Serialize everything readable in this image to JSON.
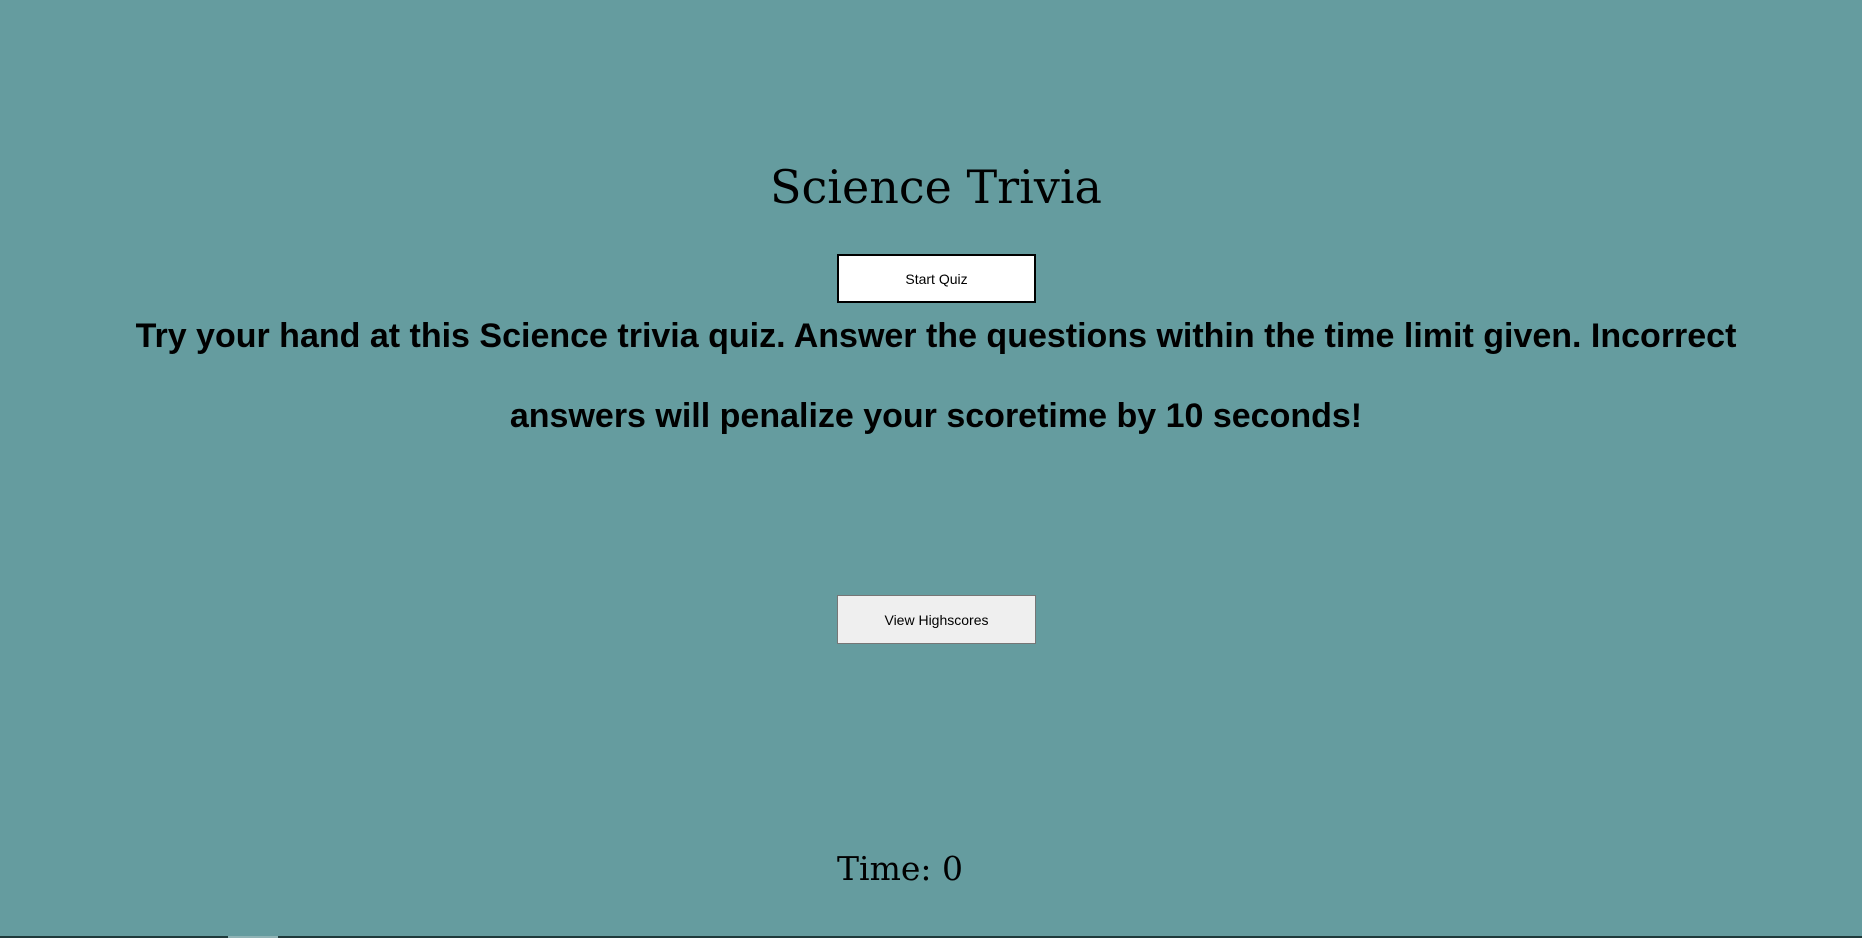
{
  "header": {
    "title": "Science Trivia"
  },
  "main": {
    "start_button_label": "Start Quiz",
    "intro_text": "Try your hand at this Science trivia quiz. Answer the questions within the time limit given. Incorrect answers will penalize your scoretime by 10 seconds!",
    "highscores_button_label": "View Highscores"
  },
  "footer": {
    "timer_text": "Time: 0"
  },
  "colors": {
    "background": "#659c9f",
    "start_button_bg": "#ffffff",
    "highscores_button_bg": "#efefef"
  }
}
